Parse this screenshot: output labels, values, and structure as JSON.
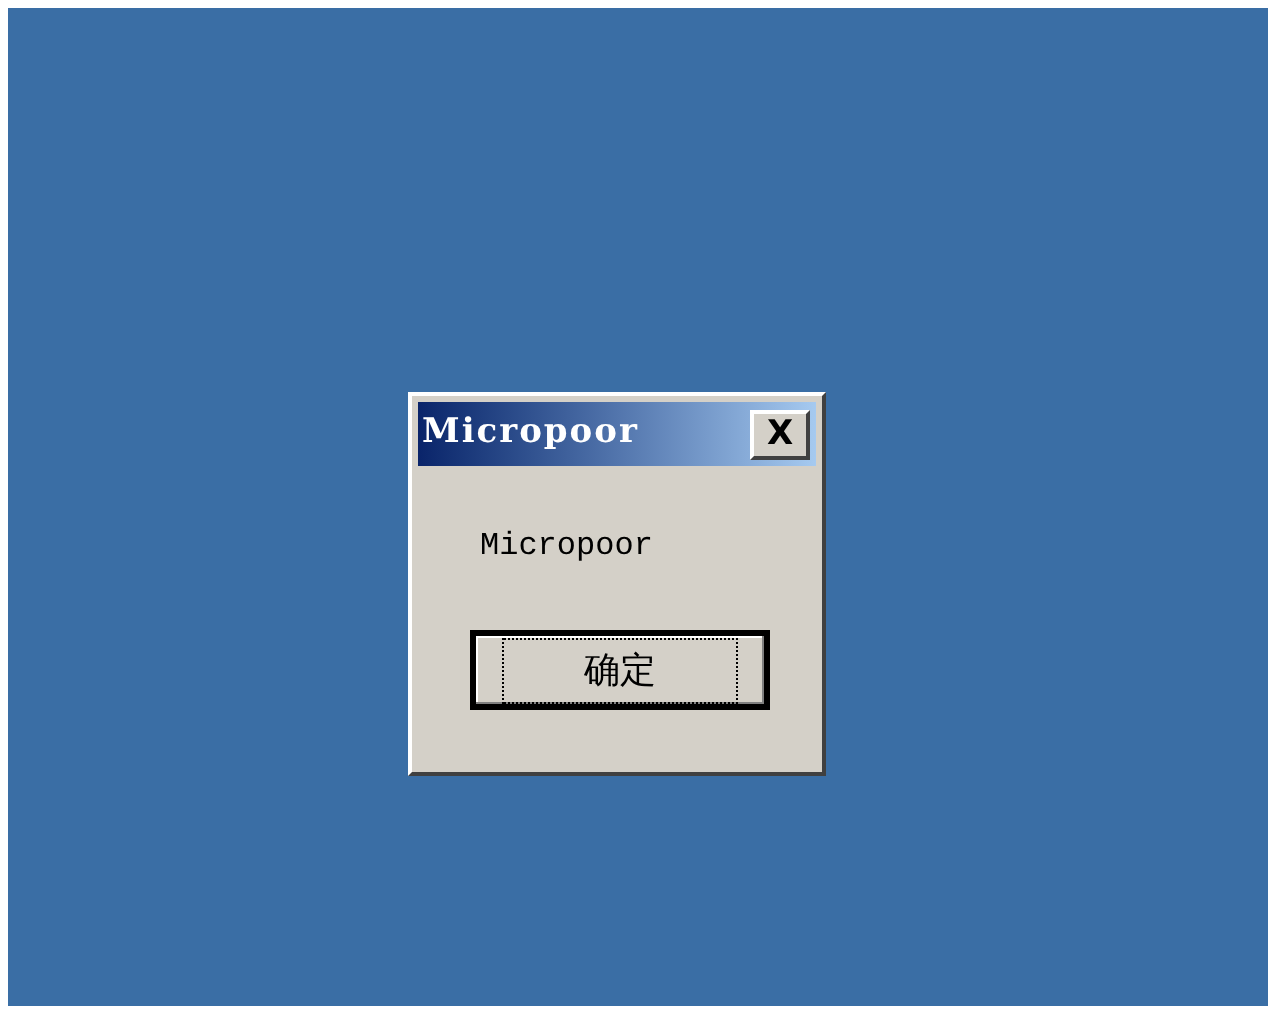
{
  "dialog": {
    "title": "Micropoor",
    "close_label": "X",
    "message": "Micropoor",
    "buttons": [
      {
        "label": "确定",
        "focused": true
      }
    ]
  }
}
